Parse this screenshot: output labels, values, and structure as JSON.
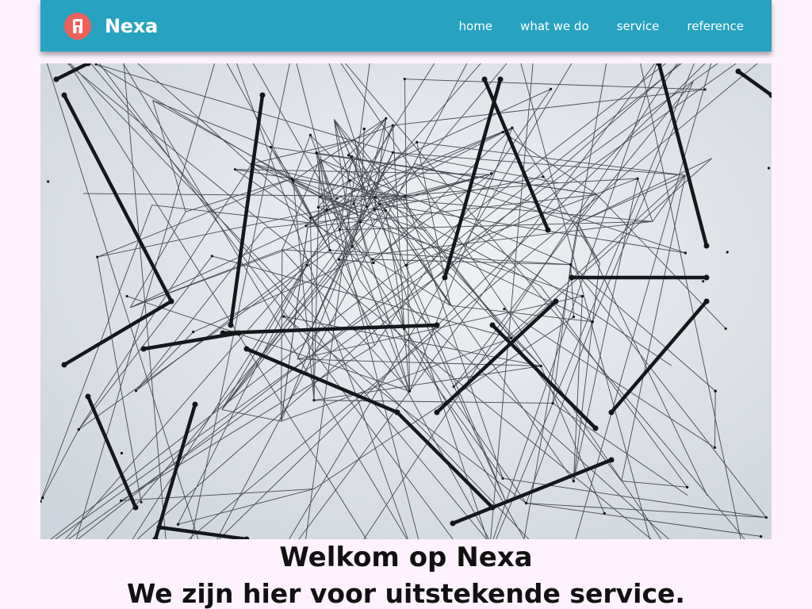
{
  "brand": {
    "name": "Nexa",
    "logo_color": "#f0605a",
    "nav_color": "#27a3c1"
  },
  "nav": {
    "items": [
      {
        "label": "home"
      },
      {
        "label": "what we do"
      },
      {
        "label": "service"
      },
      {
        "label": "reference"
      }
    ]
  },
  "hero": {
    "image_icon": "network-string-photo"
  },
  "welcome": {
    "title": "Welkom op Nexa",
    "subtitle": "We zijn hier voor uitstekende service."
  }
}
